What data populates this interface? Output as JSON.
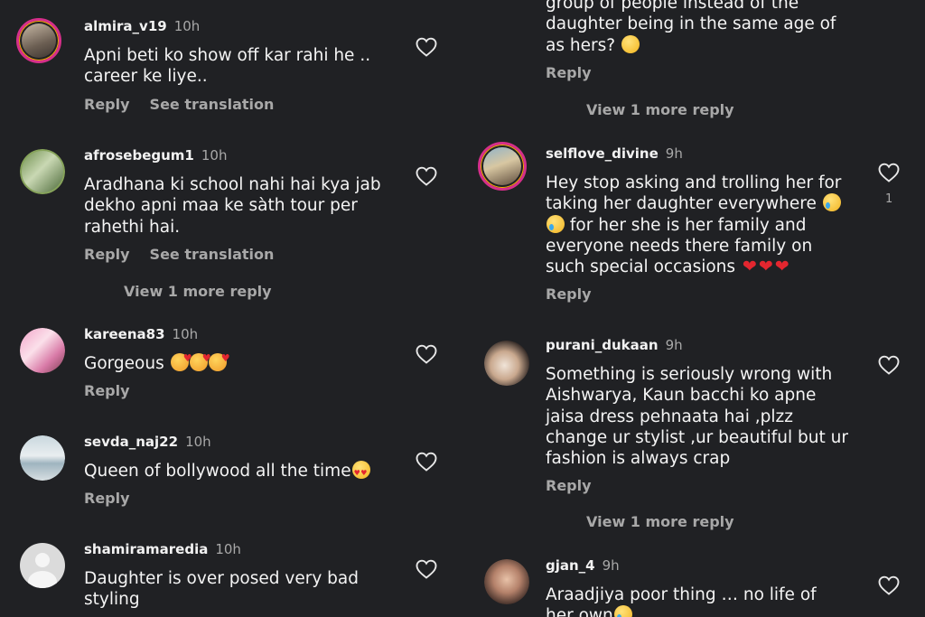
{
  "labels": {
    "reply": "Reply",
    "see_translation": "See translation",
    "view_more": "View 1 more reply"
  },
  "colors": {
    "background": "#202124",
    "text": "#f4f4f4",
    "secondary": "#a8a8a8",
    "story_ring": "#d62f8a",
    "heart_emoji": "#e3262f"
  },
  "left_comments": [
    {
      "username": "almira_v19",
      "time": "10h",
      "text": "Apni beti ko show off kar rahi he .. career ke liye.."
    },
    {
      "username": "afrosebegum1",
      "time": "10h",
      "text": "Aradhana ki school nahi hai kya jab dekho  apni maa ke sàth tour per rahethi hai."
    },
    {
      "username": "kareena83",
      "time": "10h",
      "text": "Gorgeous"
    },
    {
      "username": "sevda_naj22",
      "time": "10h",
      "text": "Queen of bollywood all the time"
    },
    {
      "username": "shamiramaredia",
      "time": "10h",
      "text": "Daughter is over posed very bad styling"
    }
  ],
  "right_comments": [
    {
      "username": "",
      "time": "",
      "text": "group of people instead of the daughter being in the same age of as hers?"
    },
    {
      "username": "selflove_divine",
      "time": "9h",
      "text": "Hey stop asking and trolling her for taking her daughter everywhere",
      "text_2": "for her she is her family and everyone needs there family on such special occasions",
      "likes": "1"
    },
    {
      "username": "purani_dukaan",
      "time": "9h",
      "text": "Something is  seriously wrong with Aishwarya, Kaun bacchi ko apne jaisa dress pehnaata hai ,plzz change ur stylist ,ur beautiful but  ur fashion is always  crap"
    },
    {
      "username": "gjan_4",
      "time": "9h",
      "text": "Araadjiya poor thing … no life of her own"
    }
  ],
  "icons": {
    "like": "heart-outline-icon",
    "emoji_laugh": "laughing-face-emoji",
    "emoji_sad": "crying-face-emoji",
    "emoji_love": "smiling-face-with-hearts-emoji",
    "emoji_eyes": "heart-eyes-emoji",
    "emoji_heart": "red-heart-emoji"
  }
}
